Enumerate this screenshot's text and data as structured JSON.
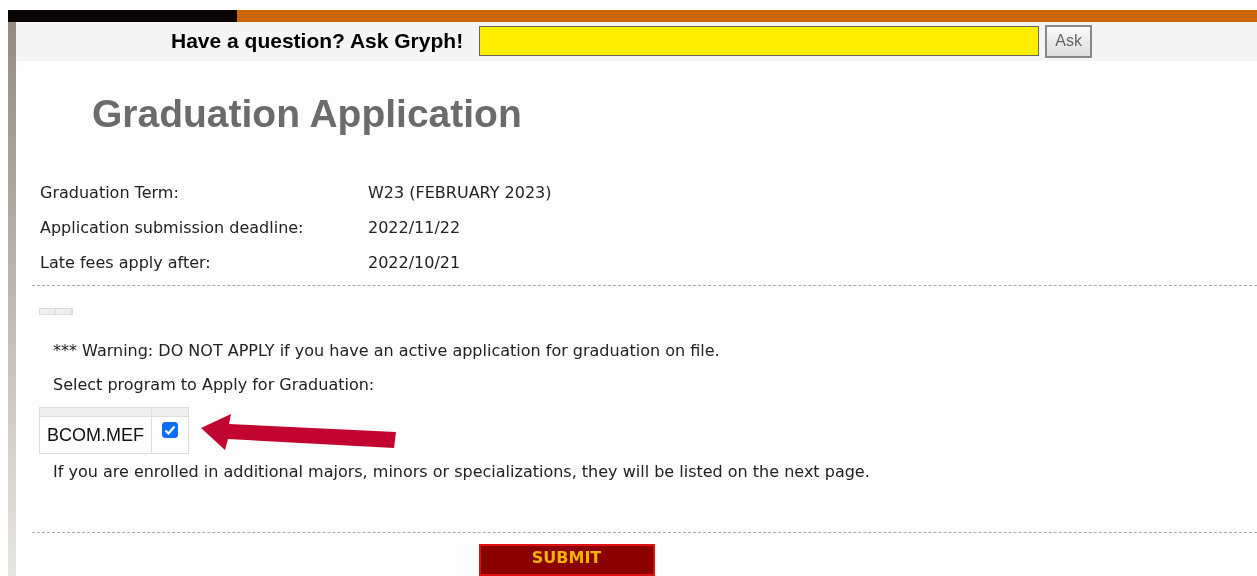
{
  "header": {
    "prompt": "Have a question? Ask Gryph!",
    "ask_button": "Ask"
  },
  "title": "Graduation Application",
  "details": [
    {
      "label": "Graduation Term:",
      "value": "W23 (FEBRUARY 2023)"
    },
    {
      "label": "Application submission deadline:",
      "value": "2022/11/22"
    },
    {
      "label": "Late fees apply after:",
      "value": "2022/10/21"
    }
  ],
  "warning": "*** Warning: DO NOT APPLY if you have an active application for graduation on file.",
  "select_label": "Select program to Apply for Graduation:",
  "programs": [
    {
      "name": "BCOM.MEF",
      "checked": true
    }
  ],
  "note": "If you are enrolled in additional majors, minors or specializations, they will be listed on the next page.",
  "submit": "SUBMIT"
}
